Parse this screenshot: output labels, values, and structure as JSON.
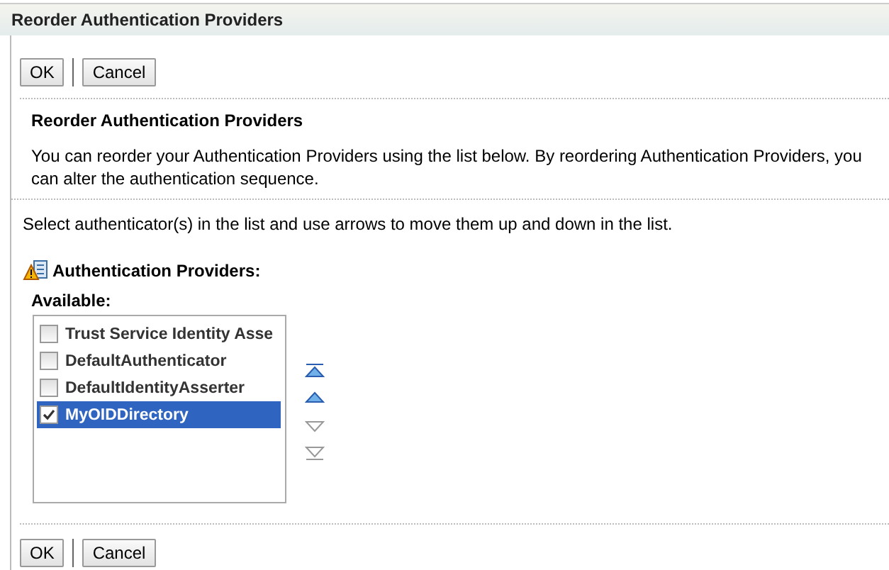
{
  "window": {
    "title": "Reorder Authentication Providers"
  },
  "top_buttons": [
    "OK",
    "Cancel"
  ],
  "section": {
    "heading": "Reorder Authentication Providers",
    "description": "You can reorder your Authentication Providers using the list below. By reordering Authentication Providers, you can alter the authentication sequence."
  },
  "instruction": "Select authenticator(s) in the list and use arrows to move them up and down in the list.",
  "providers": {
    "label": "Authentication Providers:",
    "list_label": "Available:",
    "items": [
      {
        "label": "Trust Service Identity Asse",
        "checked": false,
        "selected": false
      },
      {
        "label": "DefaultAuthenticator",
        "checked": false,
        "selected": false
      },
      {
        "label": "DefaultIdentityAsserter",
        "checked": false,
        "selected": false
      },
      {
        "label": "MyOIDDirectory",
        "checked": true,
        "selected": true
      }
    ],
    "arrows": [
      {
        "kind": "top",
        "disabled": false
      },
      {
        "kind": "up",
        "disabled": false
      },
      {
        "kind": "down",
        "disabled": true
      },
      {
        "kind": "bottom",
        "disabled": true
      }
    ]
  },
  "bottom_buttons": [
    "OK",
    "Cancel"
  ]
}
